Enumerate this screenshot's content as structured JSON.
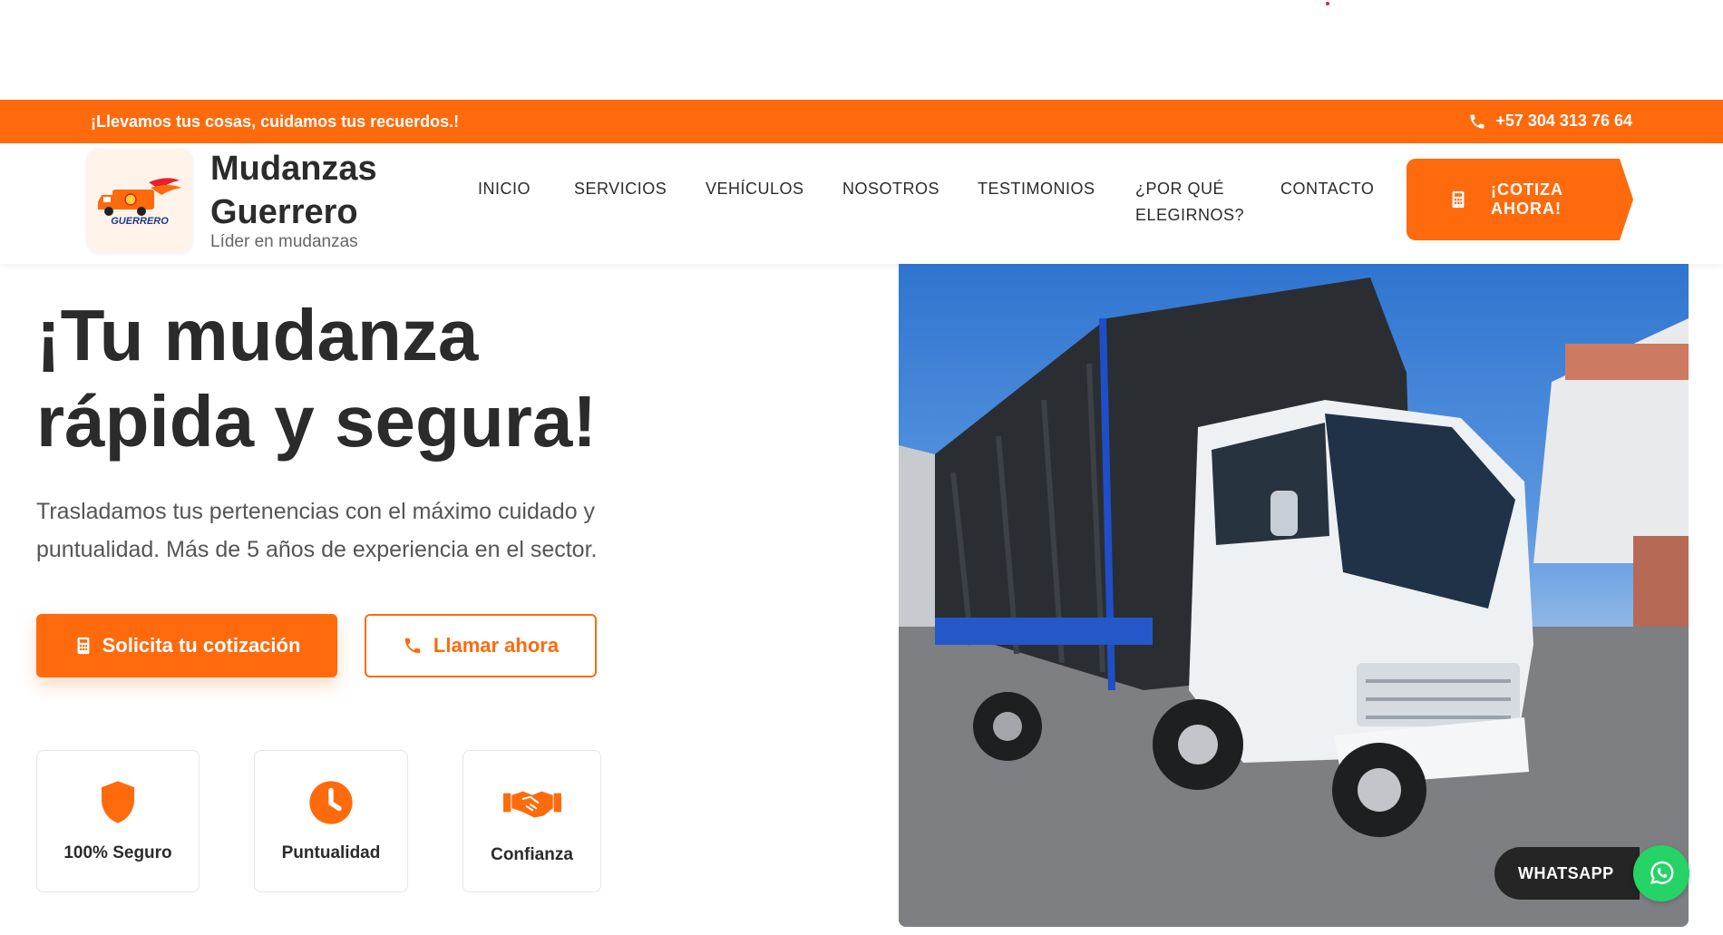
{
  "topbar": {
    "tagline": "¡Llevamos tus cosas, cuidamos tus recuerdos.!",
    "phone": "+57 304 313 76 64",
    "phone_icon": "phone-icon"
  },
  "brand": {
    "name": "Mudanzas Guerrero",
    "subtitle": "Líder en mudanzas",
    "logo_text": "GUERRERO"
  },
  "nav": {
    "items": [
      {
        "label": "INICIO"
      },
      {
        "label": "SERVICIOS"
      },
      {
        "label": "VEHÍCULOS"
      },
      {
        "label": "NOSOTROS"
      },
      {
        "label": "TESTIMONIOS"
      },
      {
        "label": "¿POR QUÉ ELEGIRNOS?"
      },
      {
        "label": "CONTACTO"
      }
    ],
    "cta": {
      "label": "¡COTIZA AHORA!",
      "icon": "calculator-icon"
    }
  },
  "hero": {
    "title": "¡Tu mudanza rápida y segura!",
    "description": "Trasladamos tus pertenencias con el máximo cuidado y puntualidad. Más de 5 años de experiencia en el sector.",
    "primary_button": {
      "label": "Solicita tu cotización",
      "icon": "calculator-icon"
    },
    "secondary_button": {
      "label": "Llamar ahora",
      "icon": "phone-icon"
    }
  },
  "features": [
    {
      "label": "100% Seguro",
      "icon": "shield-icon"
    },
    {
      "label": "Puntualidad",
      "icon": "clock-icon"
    },
    {
      "label": "Confianza",
      "icon": "handshake-icon"
    }
  ],
  "whatsapp": {
    "label": "WHATSAPP",
    "icon": "whatsapp-icon"
  },
  "colors": {
    "accent": "#ff6a0d",
    "text_dark": "#2b2b2b",
    "whatsapp_green": "#25d366",
    "whatsapp_pill": "#252525"
  }
}
